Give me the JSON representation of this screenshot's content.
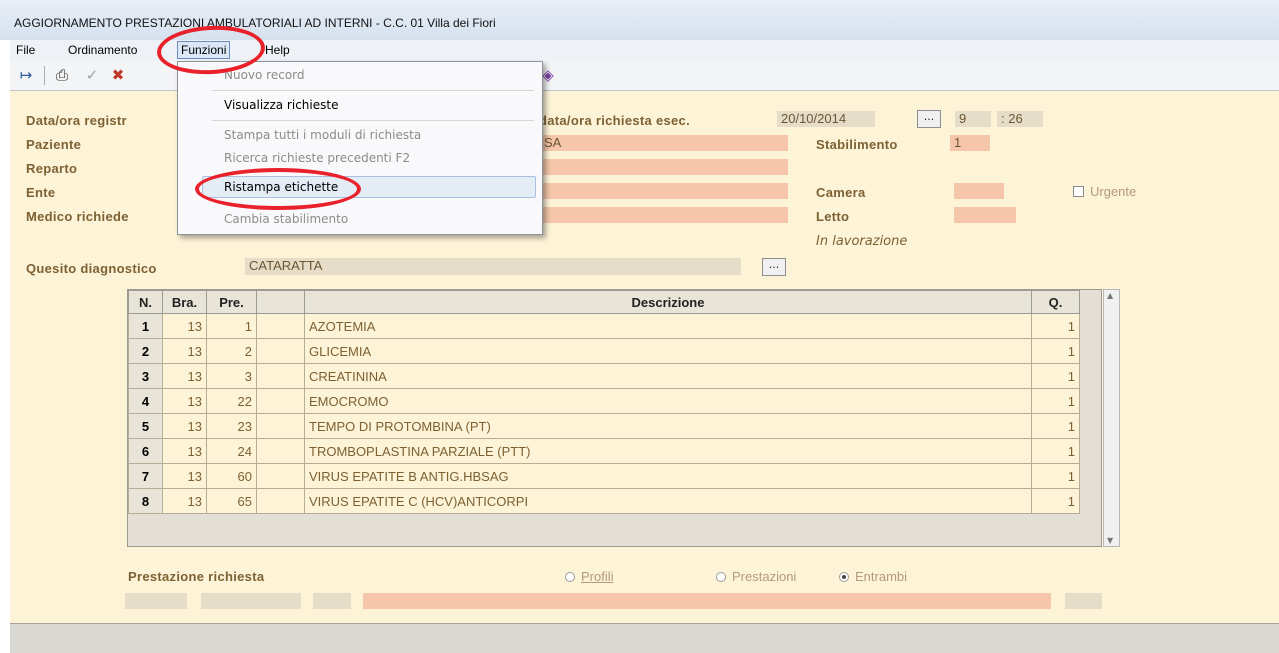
{
  "window": {
    "title": "AGGIORNAMENTO PRESTAZIONI AMBULATORIALI AD INTERNI - C.C.  01 Villa dei Fiori"
  },
  "menu": {
    "items": [
      "File",
      "Ordinamento",
      "Funzioni",
      "Help"
    ],
    "active": "Funzioni"
  },
  "toolbar": {
    "icons": [
      "exit-icon",
      "print-icon",
      "confirm-icon",
      "delete-icon",
      "book-icon"
    ]
  },
  "funzioni_menu": {
    "items": [
      {
        "label": "Nuovo record",
        "enabled": false
      },
      {
        "label": "Visualizza richieste",
        "enabled": true
      },
      {
        "label": "Stampa tutti i moduli di richiesta",
        "enabled": false
      },
      {
        "label": "Ricerca richieste precedenti F2",
        "enabled": false
      },
      {
        "label": "Ristampa etichette",
        "enabled": true,
        "highlighted": true
      },
      {
        "label": "Cambia stabilimento",
        "enabled": false
      }
    ]
  },
  "form": {
    "data_ora_registrazione_label": "Data/ora registr",
    "data_ora_richiesta_label": "data/ora richiesta esec.",
    "data_richiesta": "20/10/2014",
    "ora": "9",
    "minuti": ": 26",
    "paziente_label": "Paziente",
    "paziente_value": "SA",
    "stabilimento_label": "Stabilimento",
    "stabilimento_value": "1",
    "reparto_label": "Reparto",
    "ente_label": "Ente",
    "camera_label": "Camera",
    "urgente_label": "Urgente",
    "medico_label": "Medico richiede",
    "letto_label": "Letto",
    "stato": "In lavorazione",
    "quesito_label": "Quesito diagnostico",
    "quesito_value": "CATARATTA",
    "ellipsis": "..."
  },
  "table": {
    "headers": {
      "n": "N.",
      "bra": "Bra.",
      "pre": "Pre.",
      "desc": "Descrizione",
      "q": "Q."
    },
    "rows": [
      {
        "n": "1",
        "bra": "13",
        "pre": "1",
        "desc": "AZOTEMIA",
        "q": "1"
      },
      {
        "n": "2",
        "bra": "13",
        "pre": "2",
        "desc": "GLICEMIA",
        "q": "1"
      },
      {
        "n": "3",
        "bra": "13",
        "pre": "3",
        "desc": "CREATININA",
        "q": "1"
      },
      {
        "n": "4",
        "bra": "13",
        "pre": "22",
        "desc": "EMOCROMO",
        "q": "1"
      },
      {
        "n": "5",
        "bra": "13",
        "pre": "23",
        "desc": "TEMPO DI PROTOMBINA (PT)",
        "q": "1"
      },
      {
        "n": "6",
        "bra": "13",
        "pre": "24",
        "desc": "TROMBOPLASTINA PARZIALE (PTT)",
        "q": "1"
      },
      {
        "n": "7",
        "bra": "13",
        "pre": "60",
        "desc": "VIRUS EPATITE B ANTIG.HBSAG",
        "q": "1"
      },
      {
        "n": "8",
        "bra": "13",
        "pre": "65",
        "desc": "VIRUS EPATITE C (HCV)ANTICORPI",
        "q": "1"
      }
    ]
  },
  "prestazione": {
    "label": "Prestazione richiesta",
    "options": [
      "Profili",
      "Prestazioni",
      "Entrambi"
    ],
    "selected": "Entrambi"
  },
  "colors": {
    "form_bg": "#fdf3d7",
    "field": "#f5c6a9",
    "label": "#7d6133",
    "annotation": "#e8212a"
  }
}
